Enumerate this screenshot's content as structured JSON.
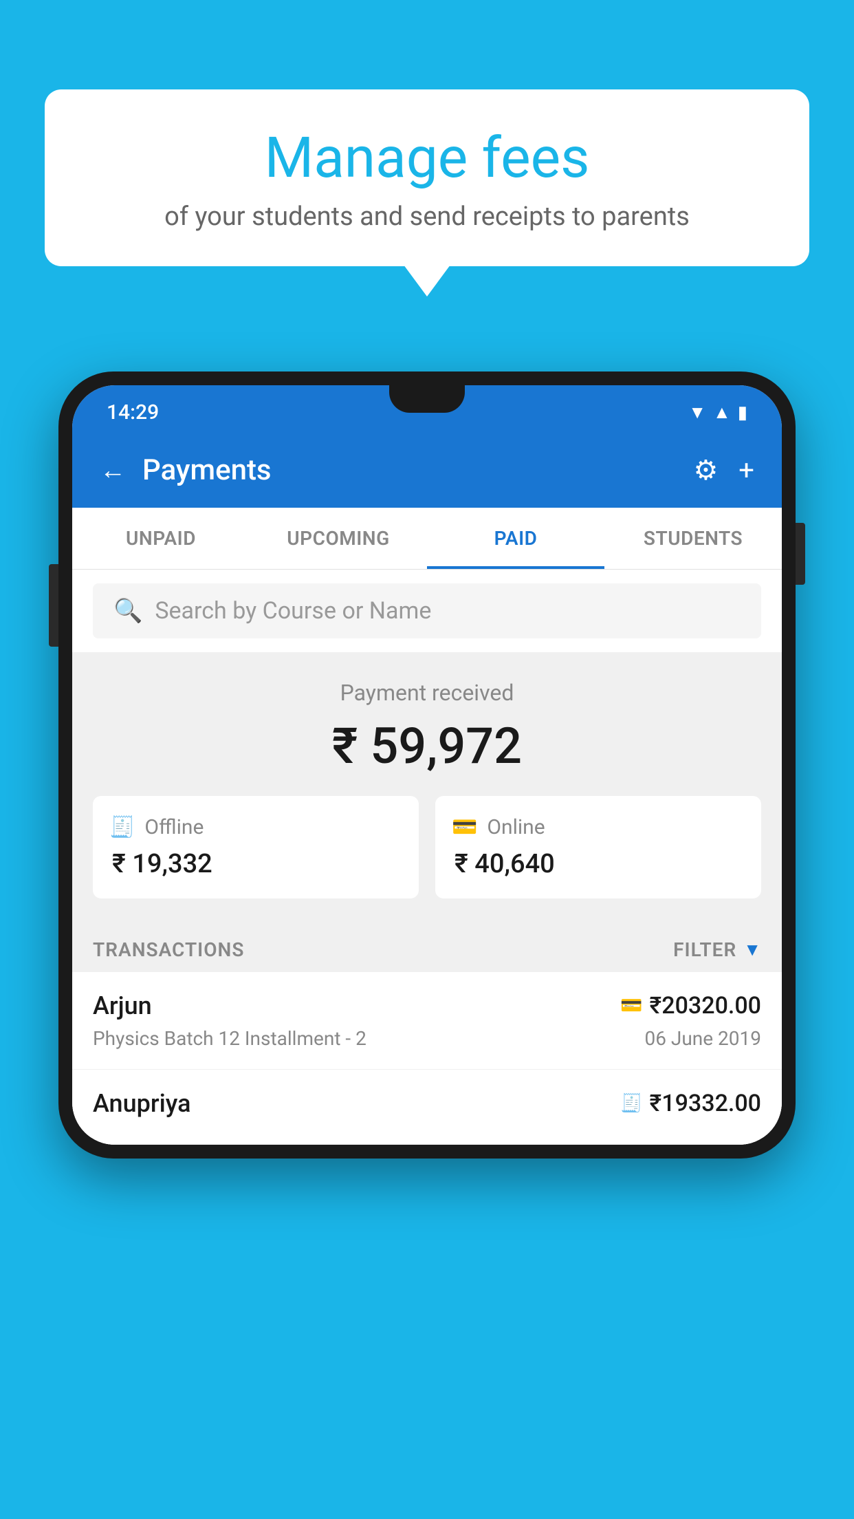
{
  "page": {
    "background_color": "#1ab5e8"
  },
  "speech_bubble": {
    "title": "Manage fees",
    "subtitle": "of your students and send receipts to parents"
  },
  "status_bar": {
    "time": "14:29",
    "wifi": "▲",
    "signal": "▲",
    "battery": "▮"
  },
  "app_header": {
    "title": "Payments",
    "back_label": "←",
    "gear_symbol": "⚙",
    "plus_symbol": "+"
  },
  "tabs": [
    {
      "label": "UNPAID",
      "active": false
    },
    {
      "label": "UPCOMING",
      "active": false
    },
    {
      "label": "PAID",
      "active": true
    },
    {
      "label": "STUDENTS",
      "active": false
    }
  ],
  "search": {
    "placeholder": "Search by Course or Name"
  },
  "payment_summary": {
    "label": "Payment received",
    "amount": "₹ 59,972",
    "offline": {
      "label": "Offline",
      "amount": "₹ 19,332"
    },
    "online": {
      "label": "Online",
      "amount": "₹ 40,640"
    }
  },
  "transactions": {
    "section_label": "TRANSACTIONS",
    "filter_label": "FILTER",
    "items": [
      {
        "name": "Arjun",
        "payment_type": "online",
        "amount": "₹20320.00",
        "course": "Physics Batch 12 Installment - 2",
        "date": "06 June 2019"
      },
      {
        "name": "Anupriya",
        "payment_type": "offline",
        "amount": "₹19332.00",
        "course": "",
        "date": ""
      }
    ]
  }
}
